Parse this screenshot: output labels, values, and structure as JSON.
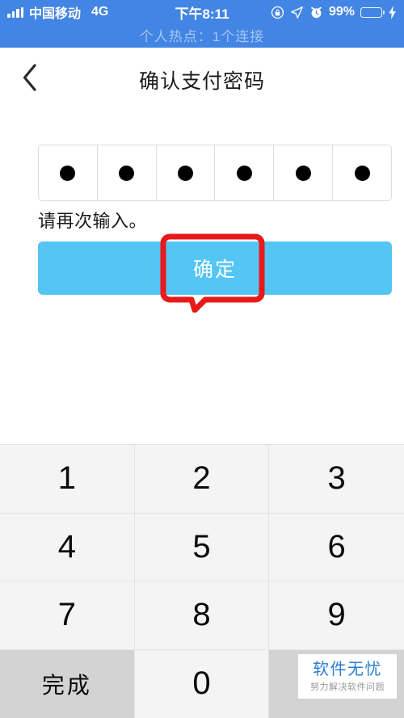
{
  "status_bar": {
    "signal_icon": "signal-bars-icon",
    "carrier": "中国移动",
    "network_type": "4G",
    "time": "下午8:11",
    "rotation_lock_icon": "rotation-lock-icon",
    "location_icon": "location-arrow-icon",
    "alarm_icon": "alarm-clock-icon",
    "battery_percent": "99%",
    "battery_icon": "battery-icon",
    "charging_icon": "lightning-bolt-icon",
    "hotspot_text": "个人热点：1个连接",
    "background_color": "#4285e4",
    "text_color": "#ffffff",
    "hotspot_text_color": "rgba(255,255,255,0.52)"
  },
  "nav_bar": {
    "back_icon": "chevron-left-icon",
    "title": "确认支付密码"
  },
  "password_field": {
    "length": 6,
    "dots": [
      "●",
      "●",
      "●",
      "●",
      "●",
      "●"
    ],
    "masked": true,
    "border_color": "#dcdcdc"
  },
  "hint": {
    "text": "请再次输入。"
  },
  "confirm_button": {
    "label": "确定",
    "background_color": "#55c5f5",
    "text_color": "#ffffff"
  },
  "annotation": {
    "shape": "callout-bubble",
    "color": "#e81919",
    "target": "确定"
  },
  "keyboard": {
    "keys": [
      {
        "label": "1",
        "style": "light"
      },
      {
        "label": "2",
        "style": "light"
      },
      {
        "label": "3",
        "style": "light"
      },
      {
        "label": "4",
        "style": "light"
      },
      {
        "label": "5",
        "style": "light"
      },
      {
        "label": "6",
        "style": "light"
      },
      {
        "label": "7",
        "style": "light"
      },
      {
        "label": "8",
        "style": "light"
      },
      {
        "label": "9",
        "style": "light"
      },
      {
        "label": "完成",
        "style": "gray"
      },
      {
        "label": "0",
        "style": "light"
      },
      {
        "label": "",
        "style": "gray"
      }
    ],
    "light_key_color": "#f4f4f4",
    "gray_key_color": "#d3d3d3"
  },
  "watermark": {
    "title": "软件无忧",
    "subtitle": "努力解决软件问题",
    "title_color": "#2b7fd0",
    "subtitle_color": "#9a9a9a"
  }
}
